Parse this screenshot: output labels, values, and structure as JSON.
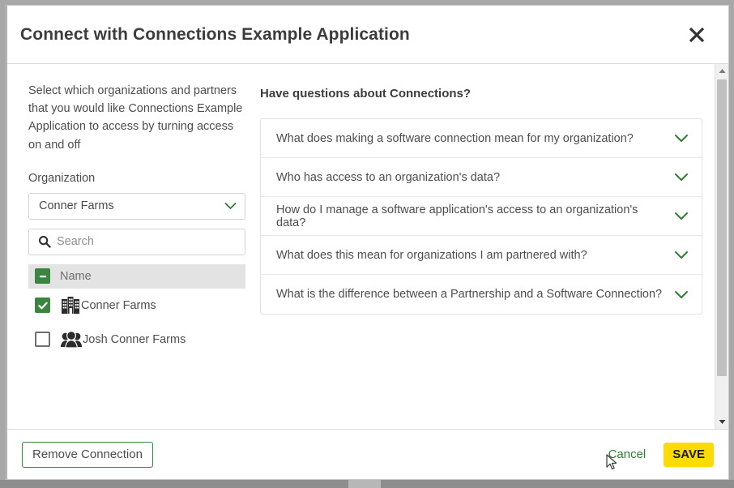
{
  "dialog": {
    "title": "Connect with Connections Example Application",
    "close_icon": "close-icon"
  },
  "left_panel": {
    "intro": "Select which organizations and partners that you would like Connections Example Application to access by turning access on and off",
    "organization_label": "Organization",
    "organization_value": "Conner Farms",
    "organization_chevron_icon": "chevron-down-icon",
    "search": {
      "placeholder": "Search",
      "value": "",
      "icon": "search-icon"
    },
    "table": {
      "header": {
        "label": "Name",
        "checkbox_state": "indeterminate"
      },
      "rows": [
        {
          "label": "Conner Farms",
          "checkbox_state": "checked",
          "icon": "building-icon"
        },
        {
          "label": "Josh Conner Farms",
          "checkbox_state": "unchecked",
          "icon": "people-group-icon"
        }
      ]
    }
  },
  "faq_panel": {
    "title": "Have questions about Connections?",
    "items": [
      {
        "question": "What does making a software connection mean for my organization?",
        "chevron_icon": "chevron-down-icon"
      },
      {
        "question": "Who has access to an organization's data?",
        "chevron_icon": "chevron-down-icon"
      },
      {
        "question": "How do I manage a software application's access to an organization's data?",
        "chevron_icon": "chevron-down-icon"
      },
      {
        "question": "What does this mean for organizations I am partnered with?",
        "chevron_icon": "chevron-down-icon"
      },
      {
        "question": "What is the difference between a Partnership and a Software Connection?",
        "chevron_icon": "chevron-down-icon"
      }
    ]
  },
  "footer": {
    "remove_label": "Remove Connection",
    "cancel_label": "Cancel",
    "save_label": "SAVE"
  },
  "colors": {
    "accent_green": "#3a8540",
    "link_green": "#2e7d32",
    "save_yellow": "#fcdb05",
    "header_row_gray": "#e3e3e3",
    "text_gray": "#4d4d4d"
  },
  "scrollbar": {
    "up_icon": "triangle-up-icon",
    "down_icon": "triangle-down-icon"
  }
}
